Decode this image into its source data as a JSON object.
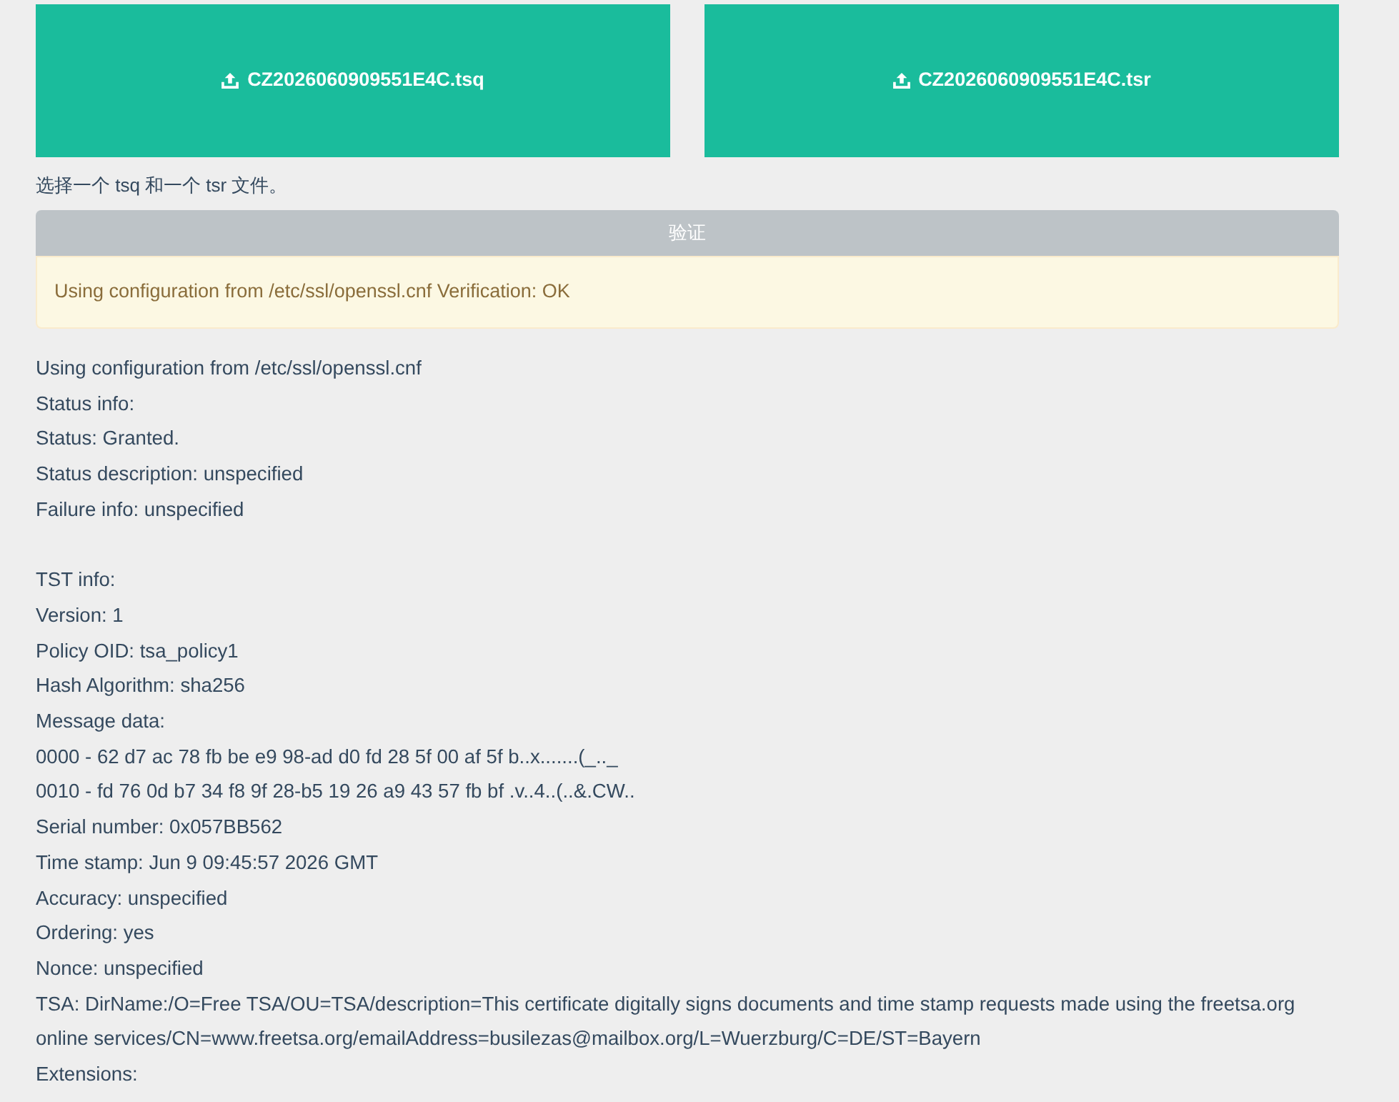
{
  "uploads": [
    {
      "filename": "CZ2026060909551E4C.tsq"
    },
    {
      "filename": "CZ2026060909551E4C.tsr"
    }
  ],
  "hint": "选择一个 tsq 和一个 tsr 文件。",
  "verify_button": {
    "label": "验证"
  },
  "alert": {
    "text": "Using configuration from /etc/ssl/openssl.cnf Verification: OK"
  },
  "output": {
    "sections": [
      {
        "lines": [
          "Using configuration from /etc/ssl/openssl.cnf",
          "Status info:",
          "Status: Granted.",
          "Status description: unspecified",
          "Failure info: unspecified"
        ]
      },
      {
        "lines": [
          "TST info:",
          "Version: 1",
          "Policy OID: tsa_policy1",
          "Hash Algorithm: sha256",
          "Message data:",
          "0000 - 62 d7 ac 78 fb be e9 98-ad d0 fd 28 5f 00 af 5f b..x.......(_.._",
          "0010 - fd 76 0d b7 34 f8 9f 28-b5 19 26 a9 43 57 fb bf .v..4..(..&.CW..",
          "Serial number: 0x057BB562",
          "Time stamp: Jun 9 09:45:57 2026 GMT",
          "Accuracy: unspecified",
          "Ordering: yes",
          "Nonce: unspecified",
          "TSA: DirName:/O=Free TSA/OU=TSA/description=This certificate digitally signs documents and time stamp requests made using the freetsa.org online services/CN=www.freetsa.org/emailAddress=busilezas@mailbox.org/L=Wuerzburg/C=DE/ST=Bayern",
          "Extensions:"
        ]
      }
    ]
  }
}
